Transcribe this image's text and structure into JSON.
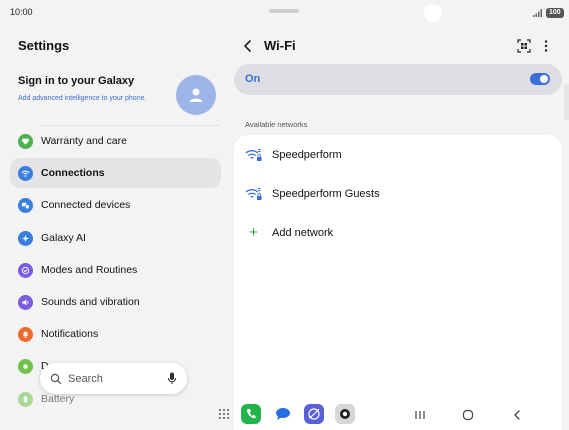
{
  "status_bar": {
    "time": "10:00",
    "battery": "100"
  },
  "left_pane": {
    "title": "Settings",
    "signin": {
      "title": "Sign in to your Galaxy",
      "subtitle": "Add advanced intelligence to your phone."
    },
    "menu": [
      {
        "label": "Warranty and care",
        "icon": "heart-icon",
        "color": "#4caf50"
      },
      {
        "label": "Connections",
        "icon": "wifi-icon",
        "color": "#3a7fe0"
      },
      {
        "label": "Connected devices",
        "icon": "devices-icon",
        "color": "#3a7fe0"
      },
      {
        "label": "Galaxy AI",
        "icon": "sparkle-icon",
        "color": "#3a7fe0"
      },
      {
        "label": "Modes and Routines",
        "icon": "check-circle-icon",
        "color": "#7a5de0"
      },
      {
        "label": "Sounds and vibration",
        "icon": "speaker-icon",
        "color": "#7a5de0"
      },
      {
        "label": "Notifications",
        "icon": "bell-icon",
        "color": "#f06a2c"
      },
      {
        "label": "D",
        "icon": "display-icon",
        "color": "#6fc24a"
      },
      {
        "label": "Battery",
        "icon": "battery-icon",
        "color": "#6fc24a"
      }
    ],
    "search": {
      "placeholder": "Search"
    }
  },
  "right_pane": {
    "title": "Wi-Fi",
    "toggle": {
      "label": "On",
      "state": "on"
    },
    "section_label": "Available networks",
    "networks": [
      {
        "name": "Speedperform",
        "icon": "wifi-lock-icon"
      },
      {
        "name": "Speedperform Guests",
        "icon": "wifi-lock-icon"
      }
    ],
    "add_network": "Add network"
  },
  "colors": {
    "accent": "#3a6fd8",
    "add": "#3a9a48"
  }
}
